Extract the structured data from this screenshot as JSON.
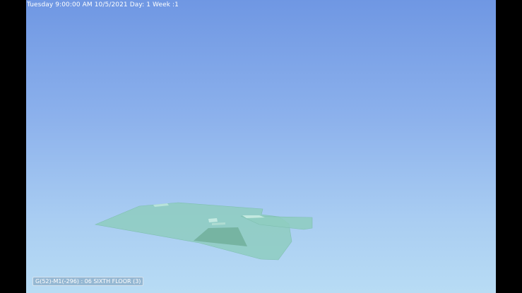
{
  "viewer": {
    "timestamp": "Tuesday 9:00:00 AM 10/5/2021 Day: 1 Week :1",
    "selection_label": "G(52)-M1(-296) : 06 SIXTH FLOOR (3)",
    "colors": {
      "sky_top": "#6f97e3",
      "sky_bottom": "#b8dcf4",
      "floor_fill": "#8ecdbf",
      "floor_dark": "#6fae98"
    }
  }
}
